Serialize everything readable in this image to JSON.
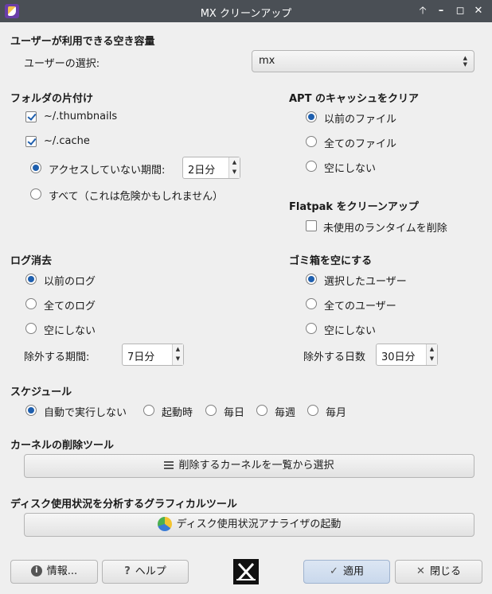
{
  "window": {
    "title": "MX クリーンアップ"
  },
  "user_space": {
    "title": "ユーザーが利用できる空き容量",
    "user_label": "ユーザーの選択:",
    "user_value": "mx"
  },
  "folders": {
    "title": "フォルダの片付け",
    "thumbnails_label": "~/.thumbnails",
    "cache_label": "~/.cache",
    "unaccessed_label": "アクセスしていない期間:",
    "unaccessed_value": "2日分",
    "all_label": "すべて（これは危険かもしれません）"
  },
  "apt": {
    "title": "APT のキャッシュをクリア",
    "options": [
      "以前のファイル",
      "全てのファイル",
      "空にしない"
    ]
  },
  "flatpak": {
    "title": "Flatpak をクリーンアップ",
    "remove_label": "未使用のランタイムを削除"
  },
  "logs": {
    "title": "ログ消去",
    "options": [
      "以前のログ",
      "全てのログ",
      "空にしない"
    ],
    "exclude_label": "除外する期間:",
    "exclude_value": "7日分"
  },
  "trash": {
    "title": "ゴミ箱を空にする",
    "options": [
      "選択したユーザー",
      "全てのユーザー",
      "空にしない"
    ],
    "exclude_label": "除外する日数",
    "exclude_value": "30日分"
  },
  "schedule": {
    "title": "スケジュール",
    "options": [
      "自動で実行しない",
      "起動時",
      "毎日",
      "毎週",
      "毎月"
    ]
  },
  "kernel": {
    "title": "カーネルの削除ツール",
    "button_label": "削除するカーネルを一覧から選択"
  },
  "disk": {
    "title": "ディスク使用状況を分析するグラフィカルツール",
    "button_label": "ディスク使用状況アナライザの起動"
  },
  "footer": {
    "about_label": "情報...",
    "help_label": "ヘルプ",
    "apply_label": "適用",
    "close_label": "閉じる"
  }
}
